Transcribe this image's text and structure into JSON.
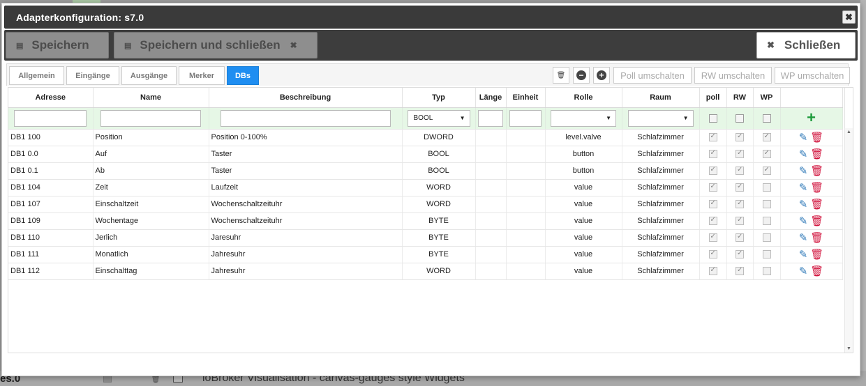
{
  "dialog": {
    "title": "Adapterkonfiguration: s7.0"
  },
  "toolbar": {
    "save_label": "Speichern",
    "save_close_label": "Speichern und schließen",
    "close_label": "Schließen"
  },
  "tabs": [
    {
      "label": "Allgemein",
      "active": false
    },
    {
      "label": "Eingänge",
      "active": false
    },
    {
      "label": "Ausgänge",
      "active": false
    },
    {
      "label": "Merker",
      "active": false
    },
    {
      "label": "DBs",
      "active": true
    }
  ],
  "actions": {
    "poll_toggle": "Poll umschalten",
    "rw_toggle": "RW umschalten",
    "wp_toggle": "WP umschalten"
  },
  "columns": [
    "Adresse",
    "Name",
    "Beschreibung",
    "Typ",
    "Länge",
    "Einheit",
    "Rolle",
    "Raum",
    "poll",
    "RW",
    "WP"
  ],
  "filters": {
    "typ_value": "BOOL"
  },
  "rows": [
    {
      "adresse": "DB1 100",
      "name": "Position",
      "beschreibung": "Position 0-100%",
      "typ": "DWORD",
      "laenge": "",
      "einheit": "",
      "rolle": "level.valve",
      "raum": "Schlafzimmer",
      "poll": true,
      "rw": true,
      "wp": true
    },
    {
      "adresse": "DB1 0.0",
      "name": "Auf",
      "beschreibung": "Taster",
      "typ": "BOOL",
      "laenge": "",
      "einheit": "",
      "rolle": "button",
      "raum": "Schlafzimmer",
      "poll": true,
      "rw": true,
      "wp": true
    },
    {
      "adresse": "DB1 0.1",
      "name": "Ab",
      "beschreibung": "Taster",
      "typ": "BOOL",
      "laenge": "",
      "einheit": "",
      "rolle": "button",
      "raum": "Schlafzimmer",
      "poll": true,
      "rw": true,
      "wp": true
    },
    {
      "adresse": "DB1 104",
      "name": "Zeit",
      "beschreibung": "Laufzeit",
      "typ": "WORD",
      "laenge": "",
      "einheit": "",
      "rolle": "value",
      "raum": "Schlafzimmer",
      "poll": true,
      "rw": true,
      "wp": false
    },
    {
      "adresse": "DB1 107",
      "name": "Einschaltzeit",
      "beschreibung": "Wochenschaltzeituhr",
      "typ": "WORD",
      "laenge": "",
      "einheit": "",
      "rolle": "value",
      "raum": "Schlafzimmer",
      "poll": true,
      "rw": true,
      "wp": false
    },
    {
      "adresse": "DB1 109",
      "name": "Wochentage",
      "beschreibung": "Wochenschaltzeituhr",
      "typ": "BYTE",
      "laenge": "",
      "einheit": "",
      "rolle": "value",
      "raum": "Schlafzimmer",
      "poll": true,
      "rw": true,
      "wp": false
    },
    {
      "adresse": "DB1 110",
      "name": "Jerlich",
      "beschreibung": "Jaresuhr",
      "typ": "BYTE",
      "laenge": "",
      "einheit": "",
      "rolle": "value",
      "raum": "Schlafzimmer",
      "poll": true,
      "rw": true,
      "wp": false
    },
    {
      "adresse": "DB1 111",
      "name": "Monatlich",
      "beschreibung": "Jahresuhr",
      "typ": "BYTE",
      "laenge": "",
      "einheit": "",
      "rolle": "value",
      "raum": "Schlafzimmer",
      "poll": true,
      "rw": true,
      "wp": false
    },
    {
      "adresse": "DB1 112",
      "name": "Einschalttag",
      "beschreibung": "Jahresuhr",
      "typ": "WORD",
      "laenge": "",
      "einheit": "",
      "rolle": "value",
      "raum": "Schlafzimmer",
      "poll": true,
      "rw": true,
      "wp": false
    }
  ],
  "background": {
    "left_text": "es.0",
    "right_text": "ioBroker Visualisation - canvas-gauges style Widgets"
  },
  "icons": {
    "save": "floppy-icon",
    "close": "x-icon",
    "delete_all": "trash-icon",
    "remove": "minus-circle-icon",
    "add": "plus-circle-icon",
    "edit": "pencil-icon",
    "delete": "trash-icon"
  },
  "colors": {
    "active_tab": "#1f8ef1",
    "filter_row": "#e6f7e6",
    "add_icon": "#1e9b3c",
    "edit_icon": "#2f79b8",
    "delete_icon": "#d0103a",
    "titlebar": "#3a3a3a"
  }
}
